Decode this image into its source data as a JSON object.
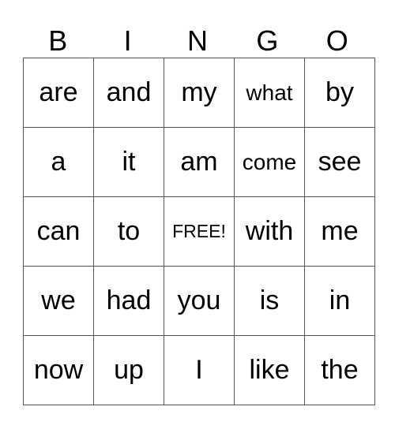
{
  "header": [
    "B",
    "I",
    "N",
    "G",
    "O"
  ],
  "board": [
    [
      "are",
      "and",
      "my",
      "what",
      "by"
    ],
    [
      "a",
      "it",
      "am",
      "come",
      "see"
    ],
    [
      "can",
      "to",
      "FREE!",
      "with",
      "me"
    ],
    [
      "we",
      "had",
      "you",
      "is",
      "in"
    ],
    [
      "now",
      "up",
      "I",
      "like",
      "the"
    ]
  ]
}
